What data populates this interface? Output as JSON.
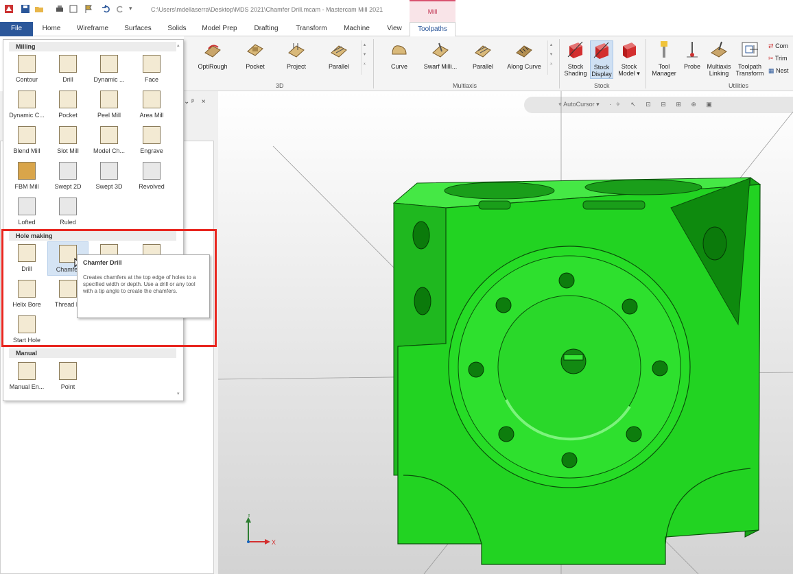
{
  "window": {
    "title": "C:\\Users\\mdellaserra\\Desktop\\MDS 2021\\Chamfer Drill.mcam - Mastercam Mill 2021",
    "context_tab": "Mill"
  },
  "ribbon_tabs": [
    "File",
    "Home",
    "Wireframe",
    "Surfaces",
    "Solids",
    "Model Prep",
    "Drafting",
    "Transform",
    "Machine",
    "View",
    "Toolpaths"
  ],
  "active_tab": "Toolpaths",
  "ribbon": {
    "group_3d": {
      "label": "3D",
      "buttons": [
        "OptiRough",
        "Pocket",
        "Project",
        "Parallel"
      ]
    },
    "group_multiaxis": {
      "label": "Multiaxis",
      "buttons": [
        "Curve",
        "Swarf Milli...",
        "Parallel",
        "Along Curve"
      ]
    },
    "group_stock": {
      "label": "Stock",
      "buttons": [
        {
          "line1": "Stock",
          "line2": "Shading"
        },
        {
          "line1": "Stock",
          "line2": "Display"
        },
        {
          "line1": "Stock",
          "line2": "Model ▾"
        }
      ]
    },
    "group_utilities": {
      "label": "Utilities",
      "buttons": [
        {
          "line1": "Tool",
          "line2": "Manager"
        },
        {
          "line1": "Probe",
          "line2": ""
        },
        {
          "line1": "Multiaxis",
          "line2": "Linking"
        },
        {
          "line1": "Toolpath",
          "line2": "Transform"
        }
      ],
      "small": [
        "Com",
        "Trim",
        "Nest"
      ]
    }
  },
  "gallery": {
    "milling": {
      "label": "Milling",
      "items": [
        "Contour",
        "Drill",
        "Dynamic ...",
        "Face",
        "Dynamic C...",
        "Pocket",
        "Peel Mill",
        "Area Mill",
        "Blend Mill",
        "Slot Mill",
        "Model Ch...",
        "Engrave",
        "FBM Mill",
        "Swept 2D",
        "Swept 3D",
        "Revolved",
        "Lofted",
        "Ruled"
      ]
    },
    "hole_making": {
      "label": "Hole making",
      "items": [
        "Drill",
        "Chamfer",
        "",
        "",
        "Helix Bore",
        "Thread M",
        "Start Hole"
      ]
    },
    "manual": {
      "label": "Manual",
      "items": [
        "Manual En...",
        "Point"
      ]
    }
  },
  "tooltip": {
    "title": "Chamfer Drill",
    "body": "Creates chamfers at the top edge of holes to a specified width or depth. Use a drill or any tool with a tip angle to create the chamfers."
  },
  "viewport": {
    "toolbar_label": "AutoCursor",
    "part_color": "#22d322",
    "axis": {
      "y": "Y",
      "x": "X"
    }
  },
  "panel_header": {
    "pin": "⌄ ᵖ",
    "close": "×"
  }
}
